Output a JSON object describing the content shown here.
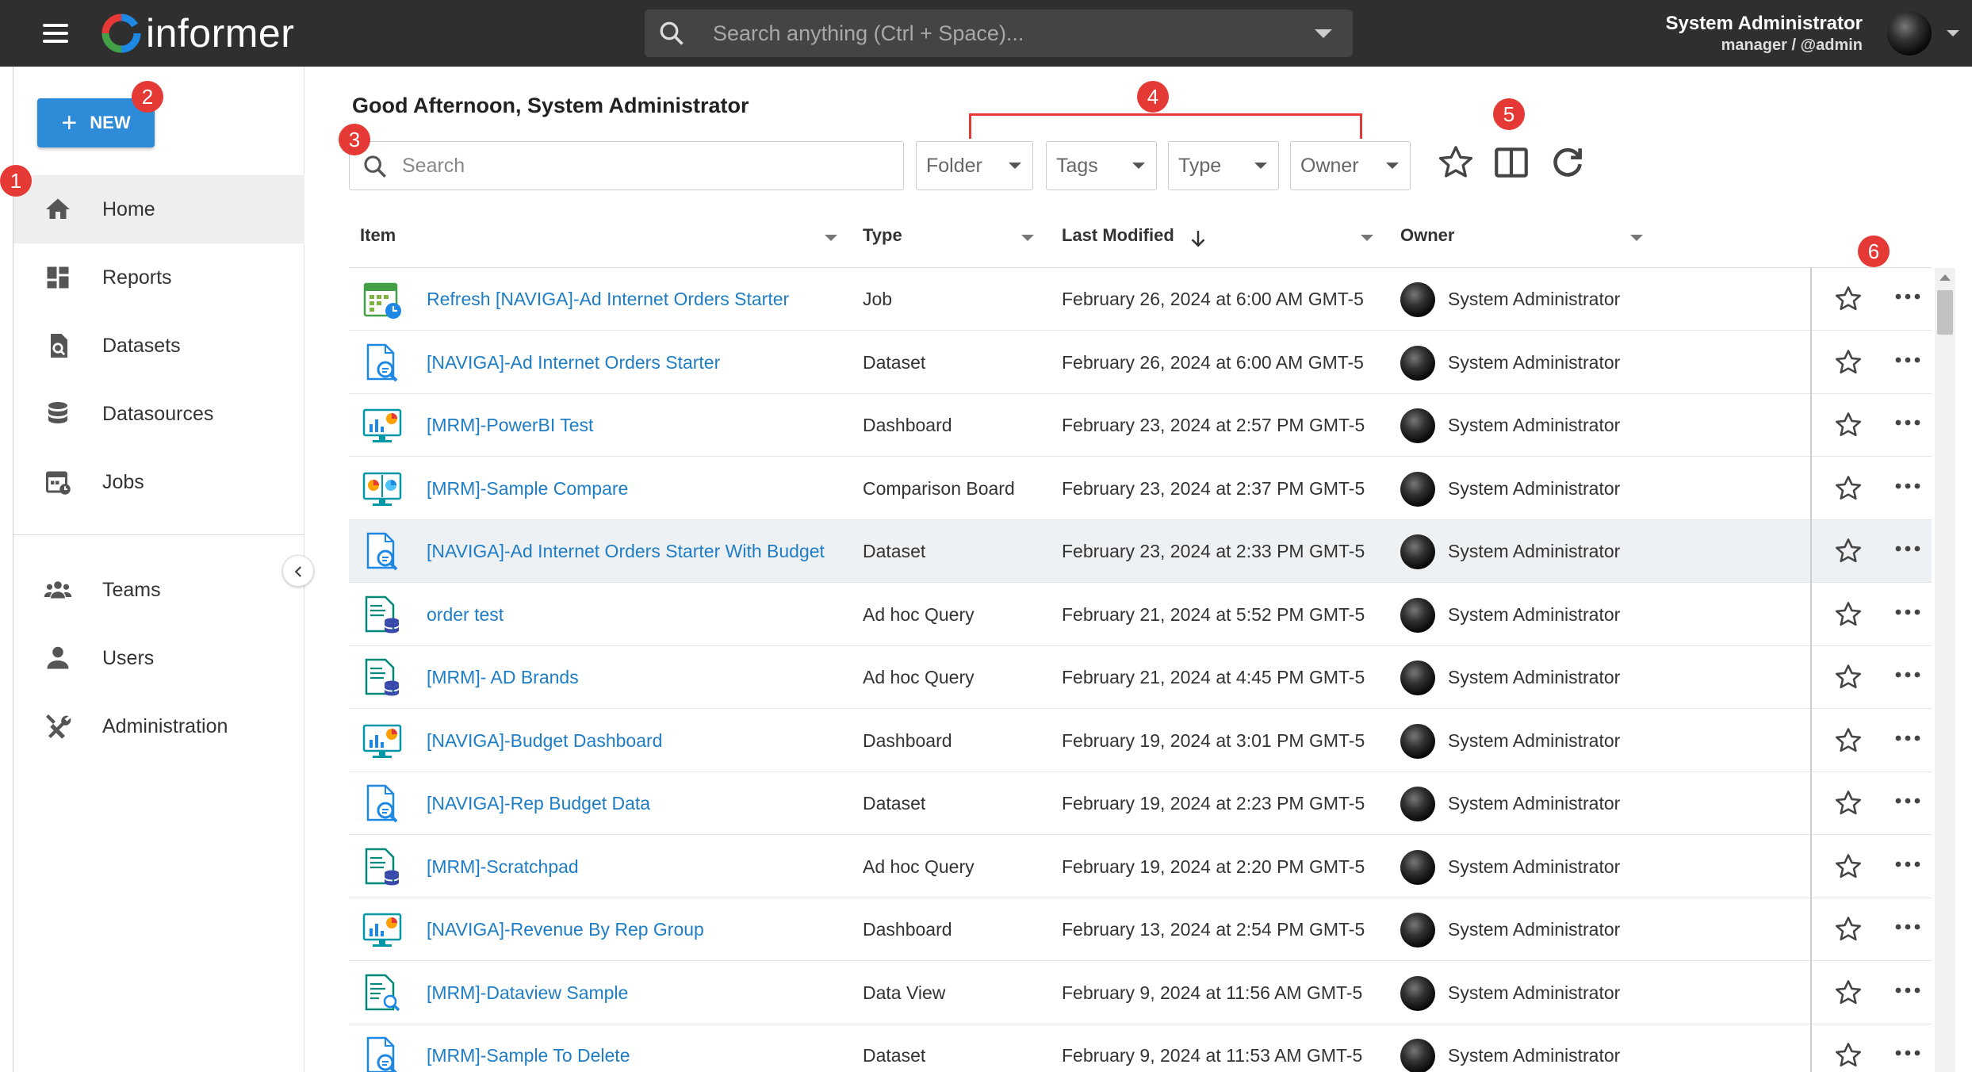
{
  "app": {
    "name": "informer"
  },
  "global_search": {
    "placeholder": "Search anything (Ctrl + Space)..."
  },
  "user": {
    "name": "System Administrator",
    "sub": "manager / @admin"
  },
  "sidebar": {
    "new_label": "NEW",
    "items": [
      {
        "label": "Home",
        "icon": "home-icon"
      },
      {
        "label": "Reports",
        "icon": "dashboard-icon"
      },
      {
        "label": "Datasets",
        "icon": "dataset-search-icon"
      },
      {
        "label": "Datasources",
        "icon": "database-icon"
      },
      {
        "label": "Jobs",
        "icon": "calendar-job-icon"
      },
      {
        "label": "Teams",
        "icon": "group-icon"
      },
      {
        "label": "Users",
        "icon": "person-icon"
      },
      {
        "label": "Administration",
        "icon": "tools-icon"
      }
    ]
  },
  "main": {
    "greeting": "Good Afternoon, System Administrator",
    "search": {
      "placeholder": "Search"
    },
    "filters": [
      "Folder",
      "Tags",
      "Type",
      "Owner"
    ]
  },
  "table": {
    "headers": {
      "item": "Item",
      "type": "Type",
      "modified": "Last Modified",
      "owner": "Owner"
    },
    "rows": [
      {
        "icon": "job",
        "name": "Refresh [NAVIGA]-Ad Internet Orders Starter",
        "type": "Job",
        "modified": "February 26, 2024 at 6:00 AM GMT-5",
        "owner": "System Administrator"
      },
      {
        "icon": "dataset",
        "name": "[NAVIGA]-Ad Internet Orders Starter",
        "type": "Dataset",
        "modified": "February 26, 2024 at 6:00 AM GMT-5",
        "owner": "System Administrator"
      },
      {
        "icon": "dashboard",
        "name": "[MRM]-PowerBI Test",
        "type": "Dashboard",
        "modified": "February 23, 2024 at 2:57 PM GMT-5",
        "owner": "System Administrator"
      },
      {
        "icon": "comparison",
        "name": "[MRM]-Sample Compare",
        "type": "Comparison Board",
        "modified": "February 23, 2024 at 2:37 PM GMT-5",
        "owner": "System Administrator"
      },
      {
        "icon": "dataset",
        "name": "[NAVIGA]-Ad Internet Orders Starter With Budget",
        "type": "Dataset",
        "modified": "February 23, 2024 at 2:33 PM GMT-5",
        "owner": "System Administrator"
      },
      {
        "icon": "query",
        "name": "order test",
        "type": "Ad hoc Query",
        "modified": "February 21, 2024 at 5:52 PM GMT-5",
        "owner": "System Administrator"
      },
      {
        "icon": "query",
        "name": "[MRM]- AD Brands",
        "type": "Ad hoc Query",
        "modified": "February 21, 2024 at 4:45 PM GMT-5",
        "owner": "System Administrator"
      },
      {
        "icon": "dashboard",
        "name": "[NAVIGA]-Budget Dashboard",
        "type": "Dashboard",
        "modified": "February 19, 2024 at 3:01 PM GMT-5",
        "owner": "System Administrator"
      },
      {
        "icon": "dataset",
        "name": "[NAVIGA]-Rep Budget Data",
        "type": "Dataset",
        "modified": "February 19, 2024 at 2:23 PM GMT-5",
        "owner": "System Administrator"
      },
      {
        "icon": "query",
        "name": "[MRM]-Scratchpad",
        "type": "Ad hoc Query",
        "modified": "February 19, 2024 at 2:20 PM GMT-5",
        "owner": "System Administrator"
      },
      {
        "icon": "dashboard",
        "name": "[NAVIGA]-Revenue By Rep Group",
        "type": "Dashboard",
        "modified": "February 13, 2024 at 2:54 PM GMT-5",
        "owner": "System Administrator"
      },
      {
        "icon": "dataview",
        "name": "[MRM]-Dataview Sample",
        "type": "Data View",
        "modified": "February 9, 2024 at 11:56 AM GMT-5",
        "owner": "System Administrator"
      },
      {
        "icon": "dataset",
        "name": "[MRM]-Sample To Delete",
        "type": "Dataset",
        "modified": "February 9, 2024 at 11:53 AM GMT-5",
        "owner": "System Administrator"
      }
    ]
  },
  "annotations": [
    "1",
    "2",
    "3",
    "4",
    "5",
    "6"
  ],
  "colors": {
    "topbar": "#2f2f2f",
    "accent": "#2e8bd8",
    "link": "#1e7dc4",
    "annotation": "#e53935"
  }
}
